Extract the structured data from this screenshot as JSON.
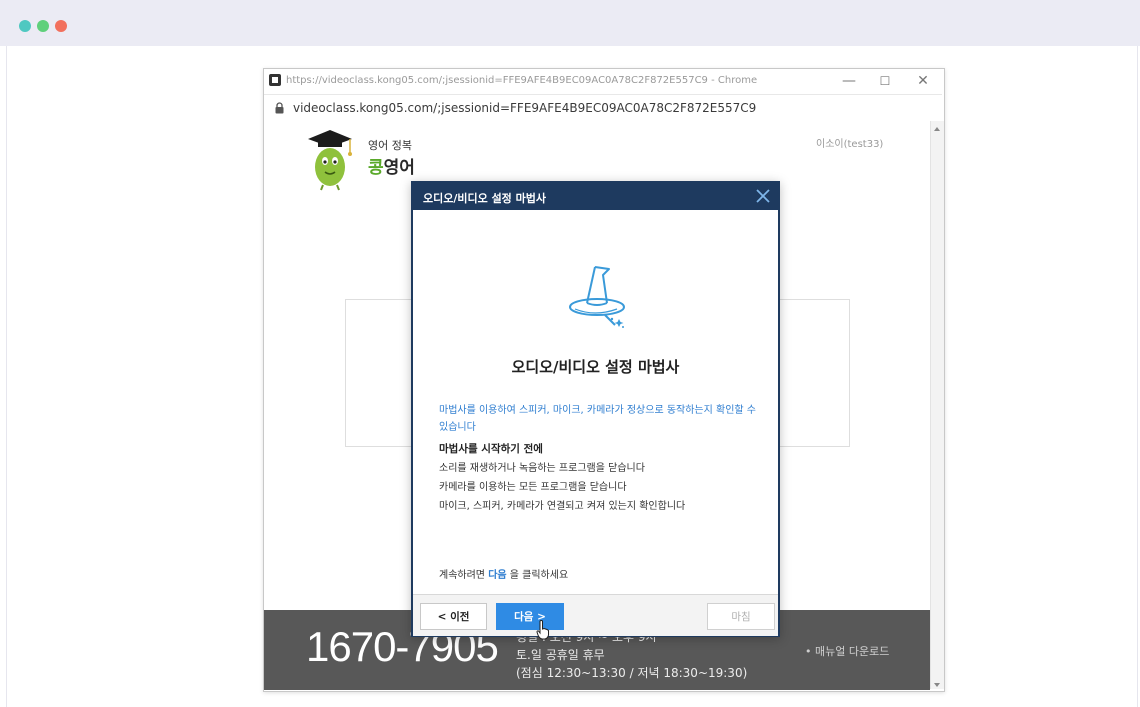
{
  "colors": {
    "dialog_header": "#1e3a5f",
    "accent_blue": "#2f8be4",
    "link_blue": "#2f7ed0",
    "footer_bg": "#585858",
    "dot_red": "#f2705d",
    "dot_teal": "#4fc8c1",
    "dot_green": "#5fd07b"
  },
  "window": {
    "title": "https://videoclass.kong05.com/;jsessionid=FFE9AFE4B9EC09AC0A78C2F872E557C9 - Chrome",
    "minimize": "—",
    "maximize": "☐",
    "close": "✕"
  },
  "address_bar": {
    "url": "videoclass.kong05.com/;jsessionid=FFE9AFE4B9EC09AC0A78C2F872E557C9"
  },
  "page": {
    "logo_subtitle": "영어 정복",
    "logo_title_accent": "콩",
    "logo_title_rest": "영어",
    "user_name": "이소이(test33)"
  },
  "footer": {
    "phone": "1670-7905",
    "hours": [
      "평일 : 오전 9시 ~ 오후 9시",
      "토.일 공휴일 휴무",
      "(점심 12:30~13:30 / 저녁 18:30~19:30)"
    ],
    "manual_link": "• 매뉴얼 다운로드"
  },
  "dialog": {
    "title": "오디오/비디오 설정 마법사",
    "heading": "오디오/비디오 설정 마법사",
    "intro": "마법사를 이용하여 스피커, 마이크, 카메라가 정상으로 동작하는지 확인할 수 있습니다",
    "before_title": "마법사를 시작하기 전에",
    "steps": [
      "소리를 재생하거나 녹음하는 프로그램을 닫습니다",
      "카메라를 이용하는 모든 프로그램을 닫습니다",
      "마이크, 스피커, 카메라가 연결되고 켜져 있는지 확인합니다"
    ],
    "continue_prefix": "계속하려면",
    "continue_highlight": "다음",
    "continue_suffix": "을 클릭하세요",
    "prev_button": "< 이전",
    "next_button": "다음 >",
    "finish_button": "마침"
  }
}
